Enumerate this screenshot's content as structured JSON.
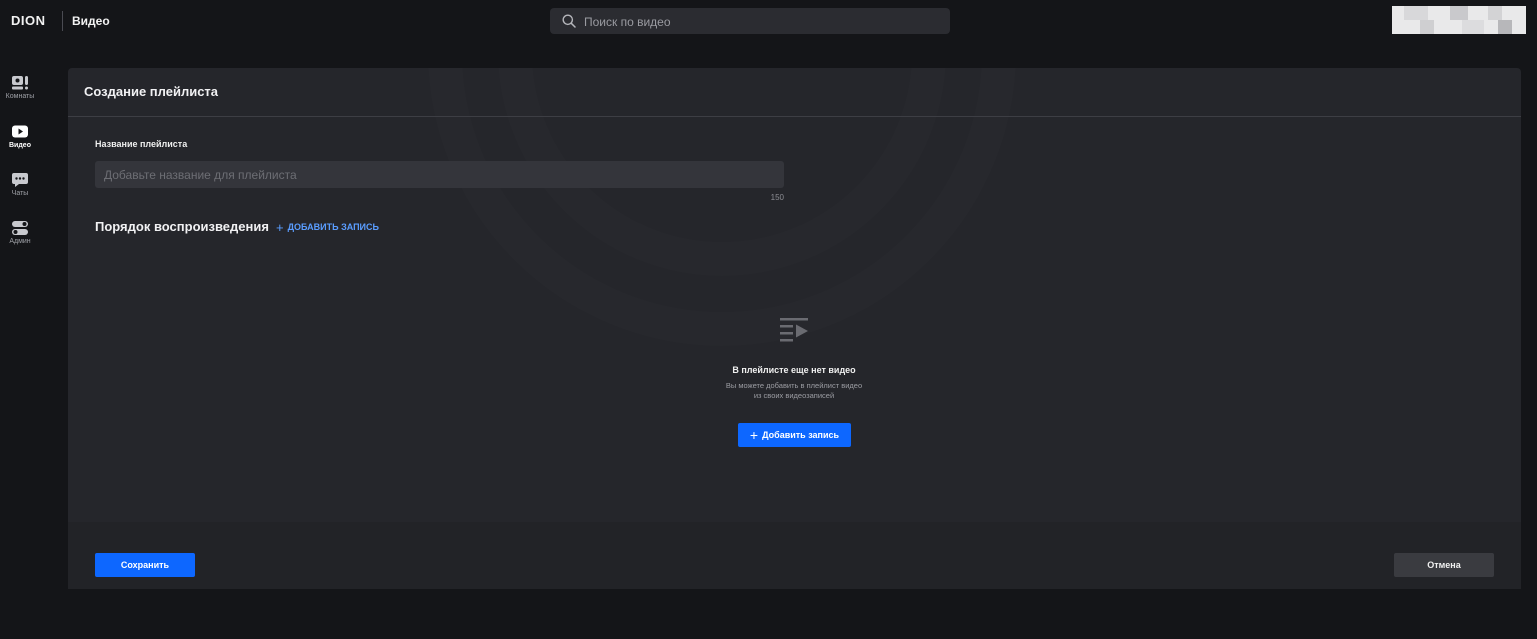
{
  "header": {
    "logo": "DION",
    "section": "Видео",
    "search": {
      "placeholder": "Поиск по видео",
      "icon": "search-icon"
    }
  },
  "sidebar": {
    "items": [
      {
        "label": "Комнаты",
        "icon": "rooms-icon",
        "active": false
      },
      {
        "label": "Видео",
        "icon": "video-play-icon",
        "active": true
      },
      {
        "label": "Чаты",
        "icon": "chat-bubble-icon",
        "active": false
      },
      {
        "label": "Админ",
        "icon": "admin-toggle-icon",
        "active": false
      }
    ]
  },
  "panel": {
    "title": "Создание плейлиста",
    "name_field": {
      "label": "Название плейлиста",
      "placeholder": "Добавьте название для плейлиста",
      "value": "",
      "max_length": "150"
    },
    "order": {
      "title": "Порядок воспроизведения",
      "add_link": "ДОБАВИТЬ ЗАПИСЬ"
    },
    "empty_state": {
      "icon": "playlist-icon",
      "title": "В плейлисте еще нет видео",
      "line1": "Вы можете добавить в плейлист видео",
      "line2": "из своих видеозаписей",
      "button": "Добавить запись"
    },
    "footer": {
      "save": "Сохранить",
      "cancel": "Отмена"
    }
  },
  "colors": {
    "accent": "#0d67ff",
    "link": "#5a9dff",
    "background": "#141518",
    "panel": "#25262b"
  }
}
